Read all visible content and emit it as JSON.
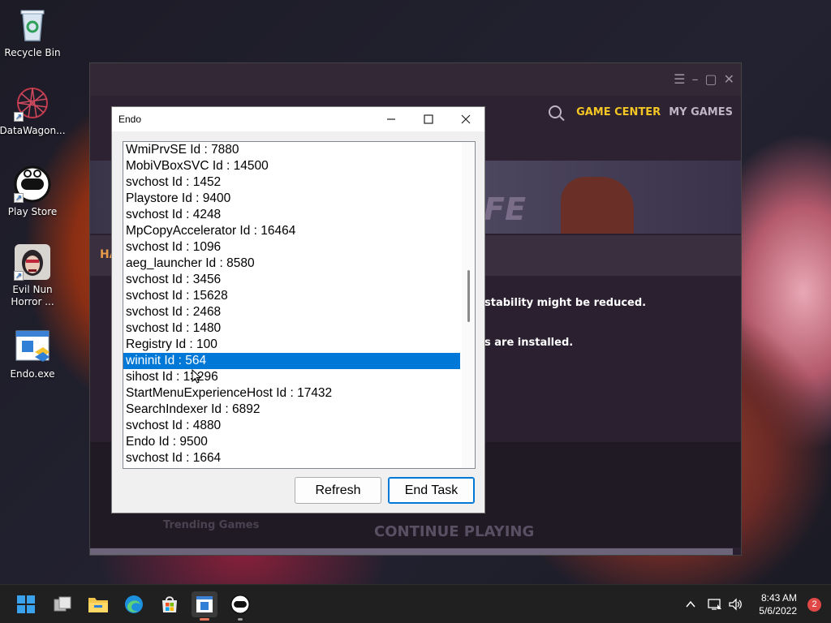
{
  "desktop": {
    "icons": [
      {
        "label": "Recycle Bin"
      },
      {
        "label": "DataWagon..."
      },
      {
        "label": "Play Store"
      },
      {
        "label": "Evil Nun Horror ..."
      },
      {
        "label": "Endo.exe"
      }
    ]
  },
  "launcher": {
    "nav": {
      "game_center": "GAME CENTER",
      "my_games": "MY GAMES"
    },
    "warning_line_1": "stability might be reduced.",
    "warning_line_2": "s are installed.",
    "banner_text": "FE",
    "warn_head": "HA",
    "trending": "Trending Games",
    "continue_playing": "CONTINUE PLAYING",
    "colors": {
      "accent": "#f3c623",
      "panel": "#2a1f2e"
    }
  },
  "endo": {
    "title": "Endo",
    "processes": [
      "WmiPrvSE Id : 7880",
      "MobiVBoxSVC Id : 14500",
      "svchost Id : 1452",
      "Playstore Id : 9400",
      "svchost Id : 4248",
      "MpCopyAccelerator Id : 16464",
      "svchost Id : 1096",
      "aeg_launcher Id : 8580",
      "svchost Id : 3456",
      "svchost Id : 15628",
      "svchost Id : 2468",
      "svchost Id : 1480",
      "Registry Id : 100",
      "wininit Id : 564",
      "sihost Id : 13296",
      "StartMenuExperienceHost Id : 17432",
      "SearchIndexer Id : 6892",
      "svchost Id : 4880",
      "Endo Id : 9500",
      "svchost Id : 1664"
    ],
    "selected_process": "wininit Id : 564",
    "buttons": {
      "refresh": "Refresh",
      "end_task": "End Task"
    },
    "colors": {
      "selection": "#0078d7"
    }
  },
  "taskbar": {
    "clock": {
      "time": "8:43 AM",
      "date": "5/6/2022"
    },
    "notification_count": "2",
    "apps": [
      "start-icon",
      "task-view-icon",
      "file-explorer-icon",
      "edge-icon",
      "store-icon",
      "endo-app-icon",
      "play-store-icon"
    ]
  }
}
